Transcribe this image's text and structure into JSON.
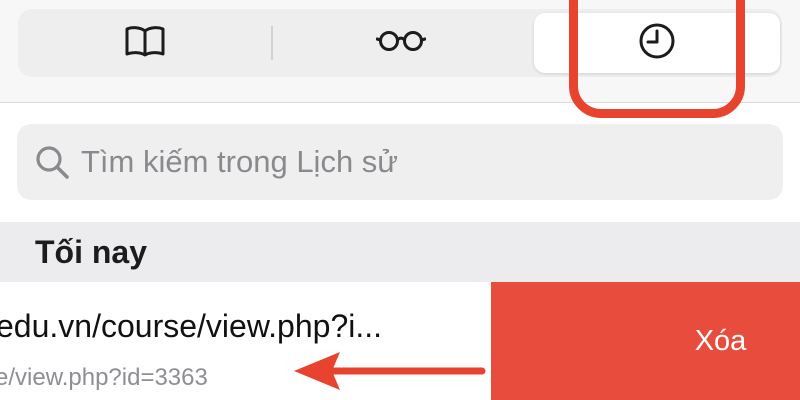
{
  "tabs": [
    {
      "icon": "book-icon",
      "selected": false
    },
    {
      "icon": "reading-glasses-icon",
      "selected": false
    },
    {
      "icon": "clock-icon",
      "selected": true
    }
  ],
  "search": {
    "placeholder": "Tìm kiếm trong Lịch sử",
    "value": ""
  },
  "section": {
    "title": "Tối nay"
  },
  "history": [
    {
      "title": "edu.vn/course/view.php?i...",
      "url": "e/view.php?id=3363"
    }
  ],
  "swipe_action": {
    "label": "Xóa"
  },
  "colors": {
    "accent_red": "#e8432f",
    "delete_red": "#e74c3c",
    "placeholder_gray": "#8a8a8e",
    "section_bg": "#ececee"
  }
}
